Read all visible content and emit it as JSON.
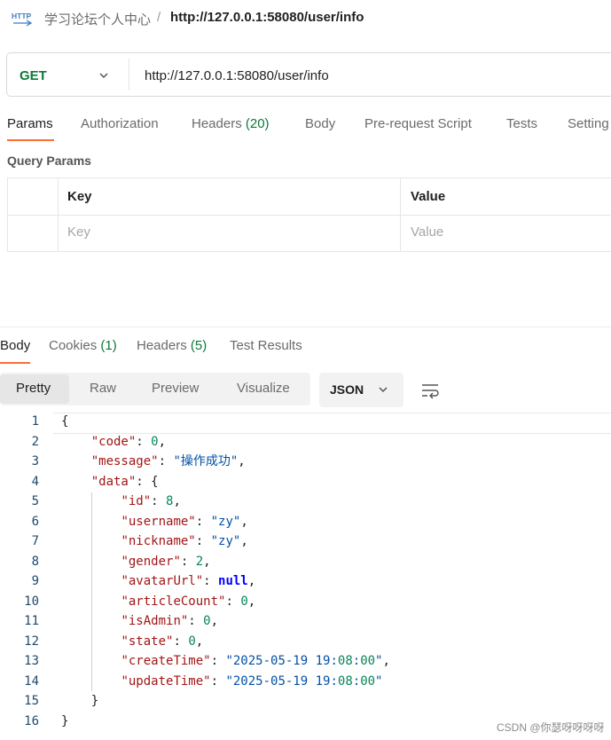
{
  "header": {
    "icon_label": "HTTP",
    "breadcrumb_parent": "学习论坛个人中心",
    "separator": "/",
    "title": "http://127.0.0.1:58080/user/info"
  },
  "request": {
    "method": "GET",
    "url": "http://127.0.0.1:58080/user/info",
    "tabs": [
      {
        "label": "Params",
        "count": ""
      },
      {
        "label": "Authorization",
        "count": ""
      },
      {
        "label": "Headers",
        "count": "(20)"
      },
      {
        "label": "Body",
        "count": ""
      },
      {
        "label": "Pre-request Script",
        "count": ""
      },
      {
        "label": "Tests",
        "count": ""
      },
      {
        "label": "Setting",
        "count": ""
      }
    ],
    "active_tab": "Params"
  },
  "query_params": {
    "title": "Query Params",
    "columns": [
      "Key",
      "Value"
    ],
    "placeholders": {
      "key": "Key",
      "value": "Value"
    }
  },
  "response": {
    "tabs": [
      {
        "label": "Body",
        "count": ""
      },
      {
        "label": "Cookies",
        "count": "(1)"
      },
      {
        "label": "Headers",
        "count": "(5)"
      },
      {
        "label": "Test Results",
        "count": ""
      }
    ],
    "active_tab": "Body",
    "view_options": [
      "Pretty",
      "Raw",
      "Preview",
      "Visualize"
    ],
    "active_view": "Pretty",
    "format": "JSON",
    "wrap_icon": "wrap-lines-icon"
  },
  "code_lines": [
    {
      "n": "1",
      "t": "{"
    },
    {
      "n": "2",
      "t": "    \"code\": 0,"
    },
    {
      "n": "3",
      "t": "    \"message\": \"操作成功\","
    },
    {
      "n": "4",
      "t": "    \"data\": {"
    },
    {
      "n": "5",
      "t": "        \"id\": 8,"
    },
    {
      "n": "6",
      "t": "        \"username\": \"zy\","
    },
    {
      "n": "7",
      "t": "        \"nickname\": \"zy\","
    },
    {
      "n": "8",
      "t": "        \"gender\": 2,"
    },
    {
      "n": "9",
      "t": "        \"avatarUrl\": null,"
    },
    {
      "n": "10",
      "t": "        \"articleCount\": 0,"
    },
    {
      "n": "11",
      "t": "        \"isAdmin\": 0,"
    },
    {
      "n": "12",
      "t": "        \"state\": 0,"
    },
    {
      "n": "13",
      "t": "        \"createTime\": \"2025-05-19 19:08:00\","
    },
    {
      "n": "14",
      "t": "        \"updateTime\": \"2025-05-19 19:08:00\""
    },
    {
      "n": "15",
      "t": "    }"
    },
    {
      "n": "16",
      "t": "}"
    }
  ],
  "watermark": "CSDN @你瑟呀呀呀呀",
  "colors": {
    "accent": "#ff6c37",
    "method_get": "#0b7a39",
    "json_key": "#a31515",
    "json_string": "#0451a5",
    "json_number": "#098658",
    "json_null": "#0000ff"
  }
}
